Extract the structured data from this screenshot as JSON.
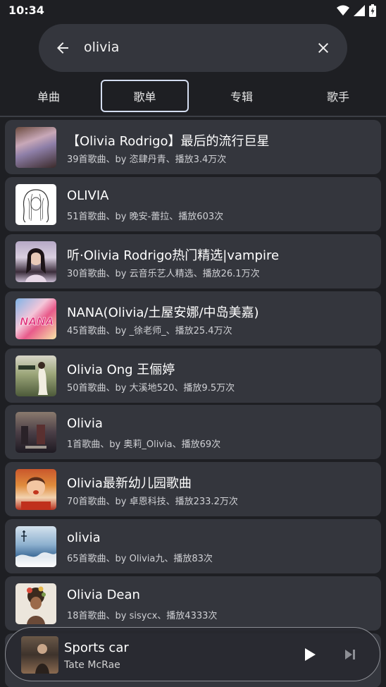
{
  "status": {
    "time": "10:34"
  },
  "search": {
    "query": "olivia"
  },
  "tabs": [
    {
      "label": "单曲"
    },
    {
      "label": "歌单"
    },
    {
      "label": "专辑"
    },
    {
      "label": "歌手"
    }
  ],
  "active_tab": "歌单",
  "playlists": [
    {
      "title": "【Olivia Rodrigo】最后的流行巨星",
      "subtitle": "39首歌曲、by 恣肆丹青、播放3.4万次"
    },
    {
      "title": "OLIVIA",
      "subtitle": "51首歌曲、by 晚安-蕾拉、播放603次"
    },
    {
      "title": "听·Olivia Rodrigo热门精选|vampire",
      "subtitle": "30首歌曲、by 云音乐艺人精选、播放26.1万次"
    },
    {
      "title": "NANA(Olivia/土屋安娜/中岛美嘉)",
      "subtitle": "45首歌曲、by _徐老师_、播放25.4万次"
    },
    {
      "title": "Olivia Ong 王俪婷",
      "subtitle": "50首歌曲、by 大溪地520、播放9.5万次"
    },
    {
      "title": "Olivia",
      "subtitle": "1首歌曲、by 奥莉_Olivia、播放69次"
    },
    {
      "title": "Olivia最新幼儿园歌曲",
      "subtitle": "70首歌曲、by 卓恩科技、播放233.2万次"
    },
    {
      "title": "olivia",
      "subtitle": "65首歌曲、by Olivia九、播放83次"
    },
    {
      "title": "Olivia Dean",
      "subtitle": "18首歌曲、by sisycx、播放4333次"
    }
  ],
  "player": {
    "title": "Sports car",
    "artist": "Tate McRae"
  },
  "colors": {
    "background": "#1e1f23",
    "card": "#34363d",
    "active_tab_border": "#d4ddf0"
  }
}
